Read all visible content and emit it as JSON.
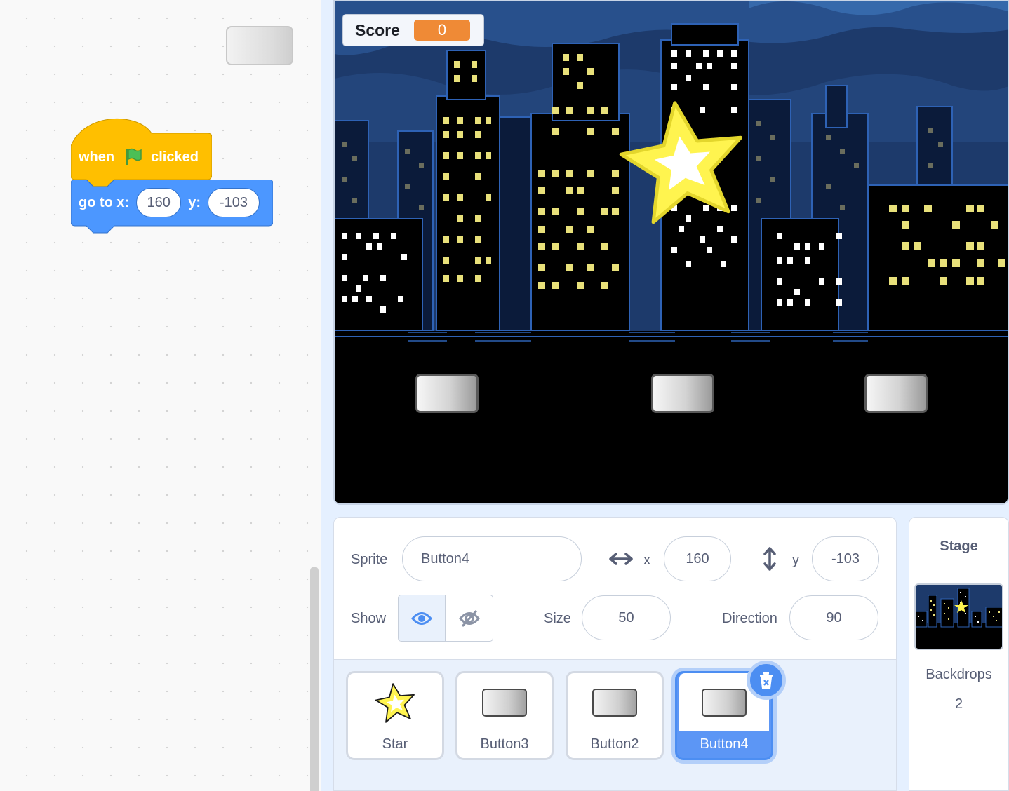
{
  "code": {
    "hat_block": {
      "when": "when",
      "flag_icon": "green-flag-icon",
      "clicked": "clicked"
    },
    "motion_block": {
      "label": "go to x:",
      "x_value": "160",
      "y_label": "y:",
      "y_value": "-103"
    }
  },
  "stage": {
    "score_label": "Score",
    "score_value": "0"
  },
  "sprite_info": {
    "sprite_label": "Sprite",
    "sprite_name": "Button4",
    "x_label": "x",
    "x_value": "160",
    "y_label": "y",
    "y_value": "-103",
    "show_label": "Show",
    "size_label": "Size",
    "size_value": "50",
    "direction_label": "Direction",
    "direction_value": "90"
  },
  "sprites": [
    {
      "name": "Star",
      "icon": "star-icon"
    },
    {
      "name": "Button3",
      "icon": "button-icon"
    },
    {
      "name": "Button2",
      "icon": "button-icon"
    },
    {
      "name": "Button4",
      "icon": "button-icon",
      "selected": true
    }
  ],
  "stage_selector": {
    "title": "Stage",
    "backdrops_label": "Backdrops",
    "backdrops_count": "2"
  },
  "colors": {
    "events": "#ffbf00",
    "motion": "#4c97ff",
    "selected": "#4c8ef2",
    "score": "#ef8a36"
  }
}
